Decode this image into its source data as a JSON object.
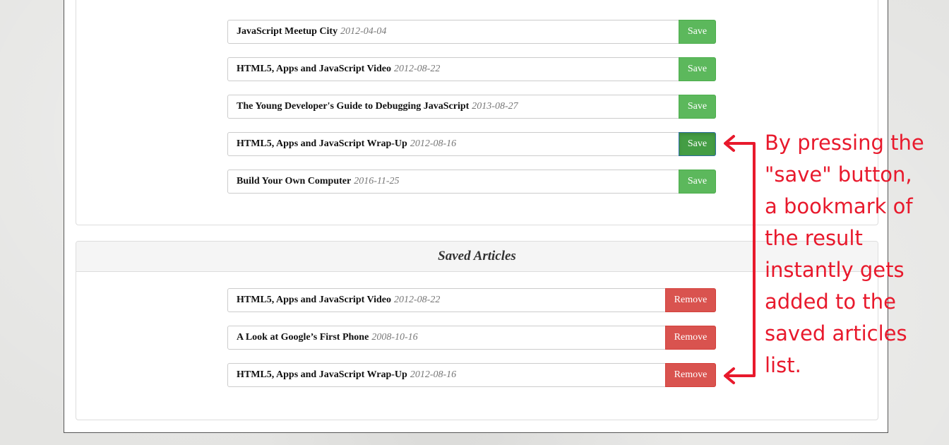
{
  "search_results": {
    "items": [
      {
        "title": "JavaScript Meetup City",
        "date": "2012-04-04",
        "button": "Save",
        "active": false
      },
      {
        "title": "HTML5, Apps and JavaScript Video",
        "date": "2012-08-22",
        "button": "Save",
        "active": false
      },
      {
        "title": "The Young Developer's Guide to Debugging JavaScript",
        "date": "2013-08-27",
        "button": "Save",
        "active": false
      },
      {
        "title": "HTML5, Apps and JavaScript Wrap-Up",
        "date": "2012-08-16",
        "button": "Save",
        "active": true
      },
      {
        "title": "Build Your Own Computer",
        "date": "2016-11-25",
        "button": "Save",
        "active": false
      }
    ]
  },
  "saved_articles": {
    "heading": "Saved Articles",
    "items": [
      {
        "title": "HTML5, Apps and JavaScript Video",
        "date": "2012-08-22",
        "button": "Remove"
      },
      {
        "title": "A Look at Google’s First Phone",
        "date": "2008-10-16",
        "button": "Remove"
      },
      {
        "title": "HTML5, Apps and JavaScript Wrap-Up",
        "date": "2012-08-16",
        "button": "Remove"
      }
    ]
  },
  "annotation": {
    "text": "By pressing the\n\"save\" button,\na bookmark of\nthe result\ninstantly gets\nadded to the\nsaved articles\nlist.",
    "color": "#e8192c"
  },
  "colors": {
    "save": "#5cb85c",
    "save_active": "#449d44",
    "remove": "#d9534f"
  }
}
